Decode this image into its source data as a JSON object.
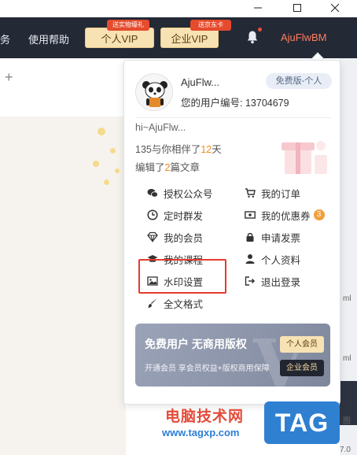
{
  "window": {
    "minimize": "—",
    "maximize": "☐",
    "close": "✕"
  },
  "topnav": {
    "cut_text": "务",
    "help": "使用帮助",
    "vip_personal": "个人VIP",
    "vip_personal_badge": "送实物壕礼",
    "vip_enterprise": "企业VIP",
    "vip_enterprise_badge": "送京东卡",
    "username": "AjuFlwBM"
  },
  "tabs": {
    "add": "+"
  },
  "panel": {
    "username": "AjuFlw...",
    "plan": "免费版-个人",
    "uid_label": "您的用户编号:",
    "uid": "13704679",
    "greeting": "hi~AjuFlw...",
    "days_prefix": "135与你相伴了",
    "days_num": "12",
    "days_suffix": "天",
    "articles_prefix": "编辑了",
    "articles_num": "2",
    "articles_suffix": "篇文章",
    "menu_left": [
      "授权公众号",
      "定时群发",
      "我的会员",
      "我的课程",
      "水印设置",
      "全文格式"
    ],
    "menu_right": [
      "我的订单",
      "我的优惠券",
      "申请发票",
      "个人资料",
      "退出登录"
    ],
    "coupon_count": "3",
    "promo": {
      "title": "免费用户 无商用版权",
      "subtitle": "开通会员 享会员权益+版权商用保障",
      "btn_personal": "个人会员",
      "btn_enterprise": "企业会员"
    }
  },
  "watermark": {
    "cn": "电脑技术网",
    "url": "www.tagxp.com",
    "logo": "TAG"
  },
  "side": {
    "s1": "ml",
    "s2": "ml",
    "s3": "图",
    "s4": "7.0"
  },
  "colors": {
    "nav_bg": "#242936",
    "accent_orange": "#f08a24",
    "highlight_red": "#e63a2e",
    "user_name": "#ff7e5e"
  }
}
